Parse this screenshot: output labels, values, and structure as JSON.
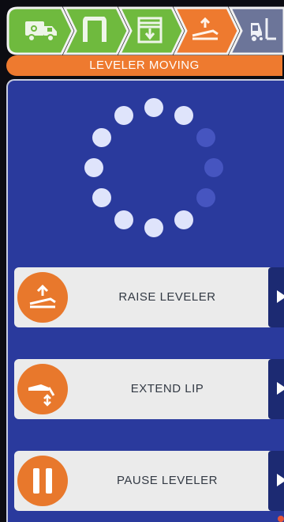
{
  "status": {
    "banner_text": "LEVELER MOVING"
  },
  "steps": [
    {
      "icon": "truck-icon",
      "state": "complete",
      "color": "#6fba3e"
    },
    {
      "icon": "dock-door-icon",
      "state": "complete",
      "color": "#6fba3e"
    },
    {
      "icon": "door-closing-icon",
      "state": "complete",
      "color": "#6fba3e"
    },
    {
      "icon": "leveler-icon",
      "state": "active",
      "color": "#ee7a2f"
    },
    {
      "icon": "forklift-icon",
      "state": "pending",
      "color": "#6c7599"
    }
  ],
  "spinner": {
    "icon": "loading-spinner-icon",
    "dot_count": 12,
    "light_color": "#dfe4fb",
    "dim_color": "#4655c0"
  },
  "actions": [
    {
      "label": "RAISE LEVELER",
      "icon": "raise-leveler-icon",
      "arrow_icon": "play-arrow-icon"
    },
    {
      "label": "EXTEND LIP",
      "icon": "extend-lip-icon",
      "arrow_icon": "play-arrow-icon"
    },
    {
      "label": "PAUSE LEVELER",
      "icon": "pause-icon",
      "arrow_icon": "play-arrow-icon"
    }
  ],
  "colors": {
    "accent_orange": "#ee7a2f",
    "step_green": "#6fba3e",
    "panel_blue": "#2a3a9d",
    "button_dark_blue": "#1c2a72"
  }
}
